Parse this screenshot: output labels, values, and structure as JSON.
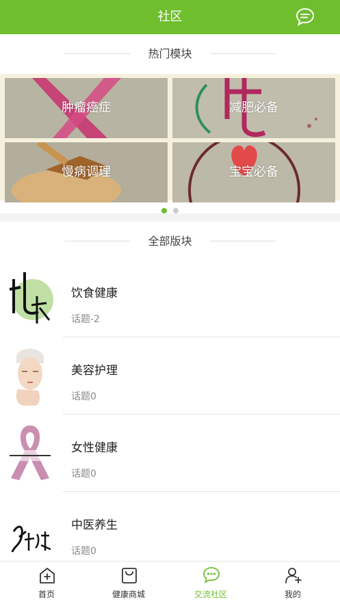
{
  "header": {
    "title": "社区",
    "message_icon": "chat-bubble-icon"
  },
  "hot": {
    "heading": "热门模块",
    "tiles": [
      {
        "label": "肿瘤癌症"
      },
      {
        "label": "减肥必备"
      },
      {
        "label": "慢病调理"
      },
      {
        "label": "宝宝必备"
      }
    ],
    "page_count": 2,
    "active_page": 1
  },
  "all": {
    "heading": "全部版块",
    "boards": [
      {
        "title": "饮食健康",
        "topics": "话题-2"
      },
      {
        "title": "美容护理",
        "topics": "话题0"
      },
      {
        "title": "女性健康",
        "topics": "话题0"
      },
      {
        "title": "中医养生",
        "topics": "话题0"
      }
    ]
  },
  "tabbar": {
    "items": [
      {
        "label": "首页",
        "icon": "home-plus-icon"
      },
      {
        "label": "健康商城",
        "icon": "shopping-bag-icon"
      },
      {
        "label": "交流社区",
        "icon": "chat-bubble-icon",
        "active": true
      },
      {
        "label": "我的",
        "icon": "user-add-icon"
      }
    ]
  },
  "colors": {
    "accent": "#6fbe2e",
    "tile_background": "#f6f1dd"
  }
}
